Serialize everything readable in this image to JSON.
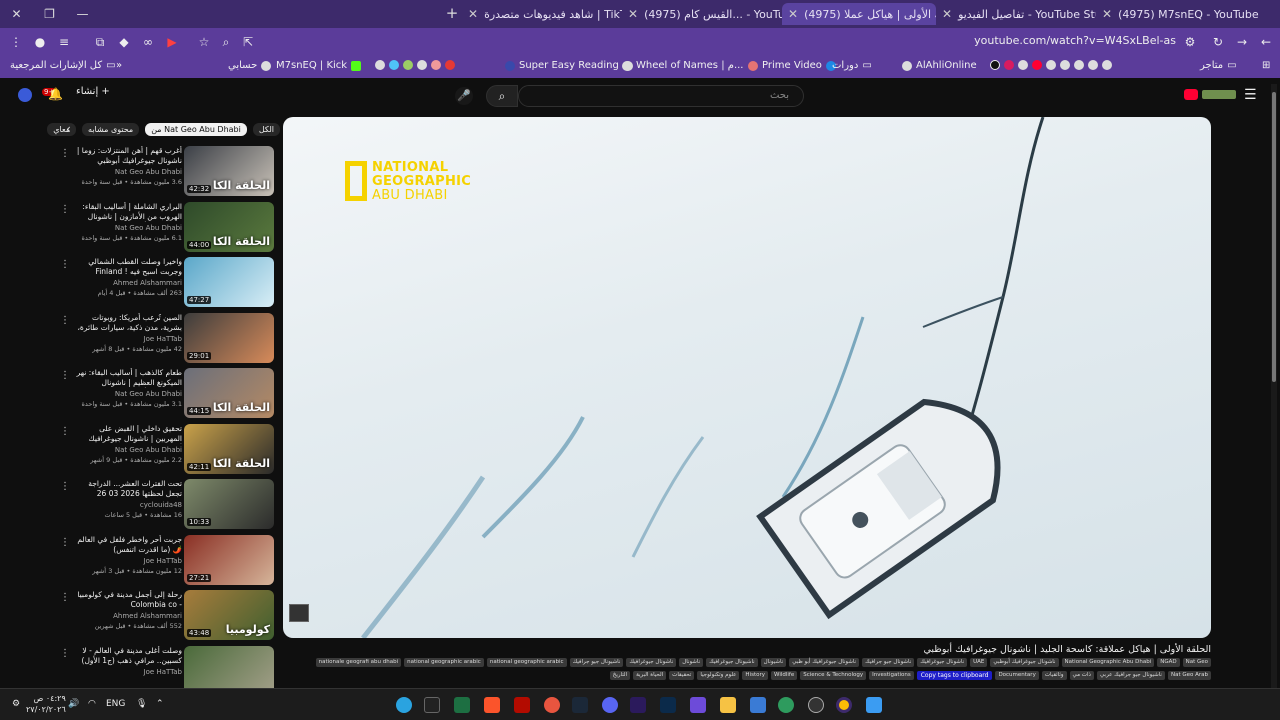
{
  "tabs": [
    {
      "title": "(4975) M7snEQ - YouTube",
      "icon": "youtube-icon",
      "active": false
    },
    {
      "title": "تفاصيل الفيديو - YouTube Studio",
      "icon": "youtube-icon",
      "active": false
    },
    {
      "title": "(4975) الحلقة الأولى | هياكل عملا...",
      "icon": "youtube-icon",
      "active": true
    },
    {
      "title": "(4975) القيس كام... - YouTube",
      "icon": "youtube-icon",
      "active": false
    },
    {
      "title": "شاهد فيديوهات متصدرة | TikTok",
      "icon": "tiktok-icon",
      "active": false
    }
  ],
  "address_bar": {
    "url": "youtube.com/watch?v=W4SxLBel-as"
  },
  "bookmarks": [
    {
      "label": "كل الإشارات المرجعية"
    },
    {
      "label": "حسابي"
    },
    {
      "label": "M7snEQ | Kick"
    },
    {
      "label": "Super Easy Reading"
    },
    {
      "label": "Wheel of Names | م..."
    },
    {
      "label": "Prime Video"
    },
    {
      "label": "دورات"
    },
    {
      "label": "AlAhliOnline"
    },
    {
      "label": "متاجر"
    }
  ],
  "header": {
    "search_placeholder": "بحث",
    "create_label": "إنشاء",
    "notification_count": "9+"
  },
  "chips": [
    {
      "label": "الكل",
      "active": false
    },
    {
      "label": "من Nat Geo Abu Dhabi",
      "active": true
    },
    {
      "label": "محتوى مشابه",
      "active": false
    },
    {
      "label": "معاي",
      "active": false
    }
  ],
  "recommendations": [
    {
      "title": "أغرب قهم | أهن المنتزلات: زوما | ناشونال جيوغرافيك أبوظبي",
      "channel": "Nat Geo Abu Dhabi",
      "meta": "3.6 مليون مشاهدة • قبل سنة واحدة",
      "duration": "42:32",
      "badge": "الحلقة الكا",
      "colors": [
        "#3b3f46",
        "#c9c2b8"
      ]
    },
    {
      "title": "البراري الشاملة | أساليب البقاء: الهروب من الأمازون | ناشونال جيوغرافيك أبوظبي",
      "channel": "Nat Geo Abu Dhabi",
      "meta": "6.1 مليون مشاهدة • قبل سنة واحدة",
      "duration": "44:00",
      "badge": "الحلقة الكا",
      "colors": [
        "#2e4a2a",
        "#5b7a3e"
      ]
    },
    {
      "title": "واخيرا وصلت القطب الشمالي وجربت اسبح فيه ! Finland",
      "channel": "Ahmed Alshammari",
      "meta": "263 ألف مشاهدة • قبل 4 أيام",
      "duration": "47:27",
      "badge": "",
      "colors": [
        "#5aa7c9",
        "#d9eef6"
      ]
    },
    {
      "title": "الصين تُرعب أمريكا: روبوتات بشرية، مدن ذكية، سيارات طائرة، وذكاء اصطناعي ب CN",
      "channel": "Joe HaTTab",
      "meta": "42 مليون مشاهدة • قبل 8 أشهر",
      "duration": "29:01",
      "badge": "",
      "colors": [
        "#3c3c3c",
        "#d88b5a"
      ]
    },
    {
      "title": "طعام كالذهب | أساليب البقاء: نهر الميكونغ العظيم | ناشونال جيوغرافيك أبوظبي",
      "channel": "Nat Geo Abu Dhabi",
      "meta": "3.1 مليون مشاهدة • قبل سنة واحدة",
      "duration": "44:15",
      "badge": "الحلقة الكا",
      "colors": [
        "#6b6f7a",
        "#b58a64"
      ]
    },
    {
      "title": "تحقيق داخلي | القبض على المهربين | ناشونال جيوغرافيك أبوظبي",
      "channel": "Nat Geo Abu Dhabi",
      "meta": "2.2 مليون مشاهدة • قبل 9 أشهر",
      "duration": "42:11",
      "badge": "الحلقة الكا",
      "colors": [
        "#caa24a",
        "#2a2a2a"
      ]
    },
    {
      "title": "تحت الفترات العشر... الدراجة تجعل لحظتها 2026 03 26",
      "channel": "cyclouida48",
      "meta": "16 مشاهدة • قبل 5 ساعات",
      "duration": "10:33",
      "badge": "",
      "colors": [
        "#7e8a6a",
        "#2b2b2b"
      ]
    },
    {
      "title": "جربت أحر واخطر فلفل في العالم 🌶️ (ما اقدرت اتنفس)",
      "channel": "Joe HaTTab",
      "meta": "12 مليون مشاهدة • قبل 3 أشهر",
      "duration": "27:21",
      "badge": "",
      "colors": [
        "#8a2f24",
        "#d6b59a"
      ]
    },
    {
      "title": "رحلة إلى أجمل مدينة في كولومبيا - Colombia co",
      "channel": "Ahmed Alshammari",
      "meta": "552 ألف مشاهدة • قبل شهرين",
      "duration": "43:48",
      "badge": "كولومبيا",
      "colors": [
        "#a77c3c",
        "#3f5f2f"
      ]
    },
    {
      "title": "وصلت أغلى مدينة في العالم - لا كسبين.. مرافي ذهب (ج1 الأول) 🇳🇴",
      "channel": "Joe HaTTab",
      "meta": "",
      "duration": "",
      "badge": "",
      "colors": [
        "#4a6a3a",
        "#a4a08a"
      ]
    }
  ],
  "video": {
    "title": "الحلقة الأولى | هياكل عملاقة: كاسحة الجليد | ناشونال جيوغرافيك أبوظبي",
    "logo_lines": [
      "NATIONAL",
      "GEOGRAPHIC",
      "ABU DHABI"
    ],
    "tags": [
      "Nat Geo",
      "NGAD",
      "National Geographic Abu Dhabi",
      "ناشونال جيوغرافيك أبوظبي",
      "UAE",
      "ناشونال جيوغرافيك",
      "ناشونال جيو جرافيك",
      "ناشونال جيوغرافيك أبو ظبي",
      "ناشيونال",
      "ناشيونال جيوغرافيك",
      "ناشونال",
      "ناشونال جيوغرافيك",
      "ناشيونال جيو جرافيك",
      "national geographic arabic",
      "national geographic arabic",
      "nationale geografi abu dhabi",
      "Nat Geo Arab",
      "ناشيونال جيو جرافيك عربي",
      "ذات مي",
      "وثائقيات",
      "Documentary",
      "Investigations",
      "Science & Technology",
      "Wildlife",
      "History",
      "علوم وتكنولوجيا",
      "تحقيقات",
      "الحياة البرية",
      "التاريخ"
    ],
    "copy_tags_label": "Copy tags to clipboard"
  },
  "taskbar": {
    "time": "٠٤:٢٩ ص",
    "date": "٢٧/٠٢/٢٠٢٦",
    "language": "ENG"
  }
}
